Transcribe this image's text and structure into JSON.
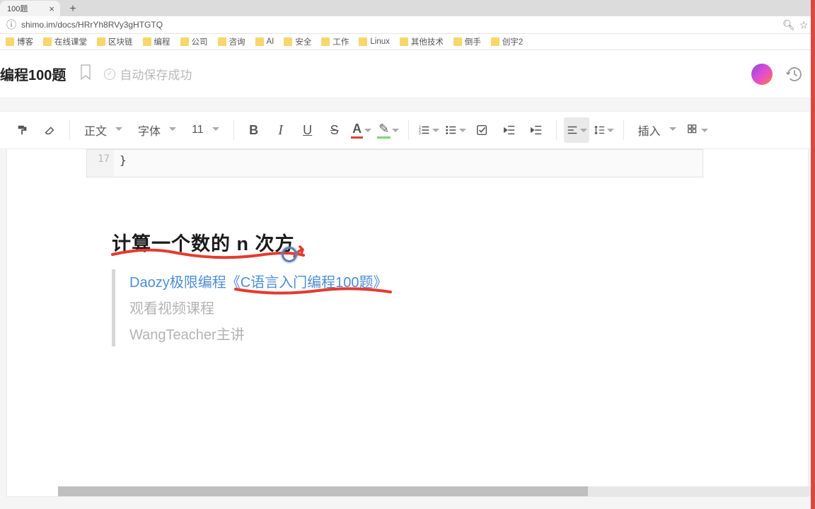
{
  "browser": {
    "tab_title": "100题",
    "new_tab_glyph": "+",
    "url": "shimo.im/docs/HRrYh8RVy3gHTGTQ",
    "search_icon": "⦿",
    "star_icon": "☆"
  },
  "bookmarks": [
    "博客",
    "在线课堂",
    "区块链",
    "编程",
    "公司",
    "咨询",
    "AI",
    "安全",
    "工作",
    "Linux",
    "其他技术",
    "倒手",
    "创宇2"
  ],
  "doc": {
    "title": "编程100题",
    "bookmark_glyph": "⃟",
    "save_status": "自动保存成功"
  },
  "toolbar": {
    "paint_format": "format-painter-icon",
    "clear_format": "eraser-icon",
    "style_label": "正文",
    "font_label": "字体",
    "size_label": "11",
    "bold": "B",
    "italic": "I",
    "underline": "U",
    "strike": "S",
    "insert_label": "插入"
  },
  "code": {
    "line_no": "17",
    "text": "}"
  },
  "content": {
    "heading": "计算一个数的 n 次方",
    "quote_line1": "Daozy极限编程《C语言入门编程100题》",
    "quote_line2": "观看视频课程",
    "quote_line3": "WangTeacher主讲"
  }
}
